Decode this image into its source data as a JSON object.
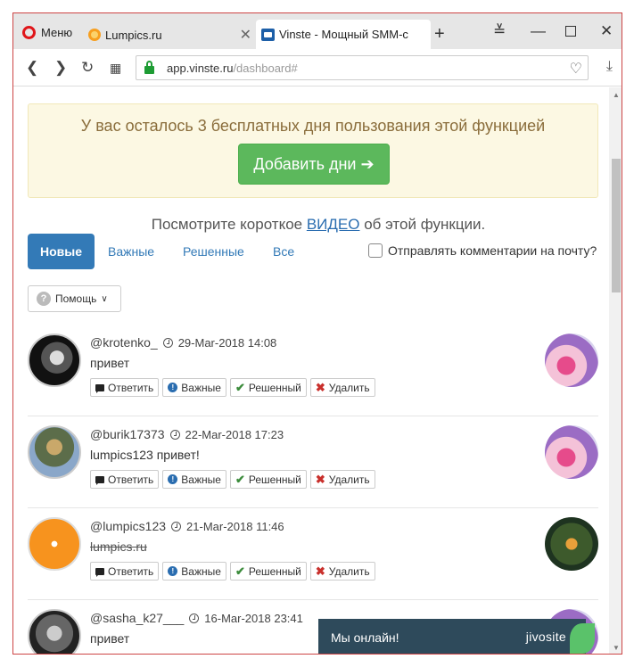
{
  "browser": {
    "menu_label": "Меню",
    "tabs": [
      {
        "title": "Lumpics.ru"
      },
      {
        "title": "Vinste - Мощный SMM-с"
      }
    ],
    "new_tab": "+",
    "url_main": "app.vinste.ru",
    "url_path": "/dashboard#"
  },
  "trial": {
    "message": "У вас осталось 3 бесплатных дня пользования этой функцией",
    "button_label": "Добавить дни ➔"
  },
  "video_line": {
    "before": "Посмотрите короткое ",
    "link": "ВИДЕО",
    "after": " об этой функции."
  },
  "filters": {
    "tabs": [
      "Новые",
      "Важные",
      "Решенные",
      "Все"
    ],
    "active": "Новые",
    "email_label": "Отправлять комментарии на почту?"
  },
  "help_label": "Помощь",
  "actions": {
    "reply": "Ответить",
    "important": "Важные",
    "resolved": "Решенный",
    "delete": "Удалить"
  },
  "comments": [
    {
      "user": "@krotenko_",
      "date": "29-Mar-2018 14:08",
      "text": "привет",
      "strike": false
    },
    {
      "user": "@burik17373",
      "date": "22-Mar-2018 17:23",
      "text": "lumpics123 привет!",
      "strike": false
    },
    {
      "user": "@lumpics123",
      "date": "21-Mar-2018 11:46",
      "text": "lumpics.ru",
      "strike": true
    },
    {
      "user": "@sasha_k27___",
      "date": "16-Mar-2018 23:41",
      "text": "привет",
      "strike": false
    }
  ],
  "chat": {
    "status": "Мы онлайн!",
    "brand": "jivosite"
  },
  "colors": {
    "primary": "#337ab7",
    "success": "#5cb85c",
    "warning_bg": "#fcf8e3",
    "chat_bg": "#2e4a5b"
  }
}
